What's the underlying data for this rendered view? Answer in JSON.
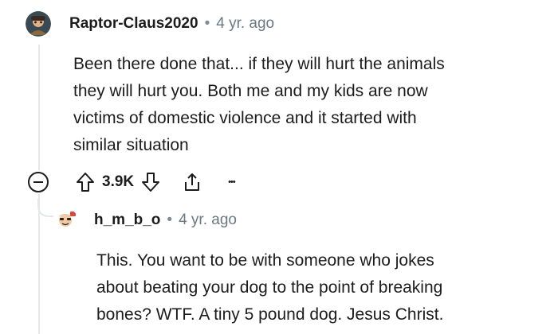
{
  "comments": [
    {
      "username": "Raptor-Claus2020",
      "separator": "•",
      "time": "4 yr. ago",
      "body_lines": [
        "Been there done that... if they will hurt the animals",
        "they will hurt you. Both me and my kids are now",
        "victims of domestic violence and it started with",
        "similar situation"
      ],
      "score": "3.9K",
      "more_label": "•••",
      "icons": [
        "collapse-minus-icon",
        "upvote-arrow-icon",
        "downvote-arrow-icon",
        "share-icon",
        "more-options-icon"
      ]
    },
    {
      "username": "h_m_b_o",
      "separator": "•",
      "time": "4 yr. ago",
      "body_lines": [
        "This. You want to be with someone who jokes",
        "about beating your dog to the point of breaking",
        "bones? WTF. A tiny 5 pound dog. Jesus Christ."
      ]
    }
  ],
  "colors": {
    "text": "#1c1c1c",
    "meta": "#6a7882",
    "thread_line": "#e5e8ea",
    "icon": "#1c1c1c"
  }
}
